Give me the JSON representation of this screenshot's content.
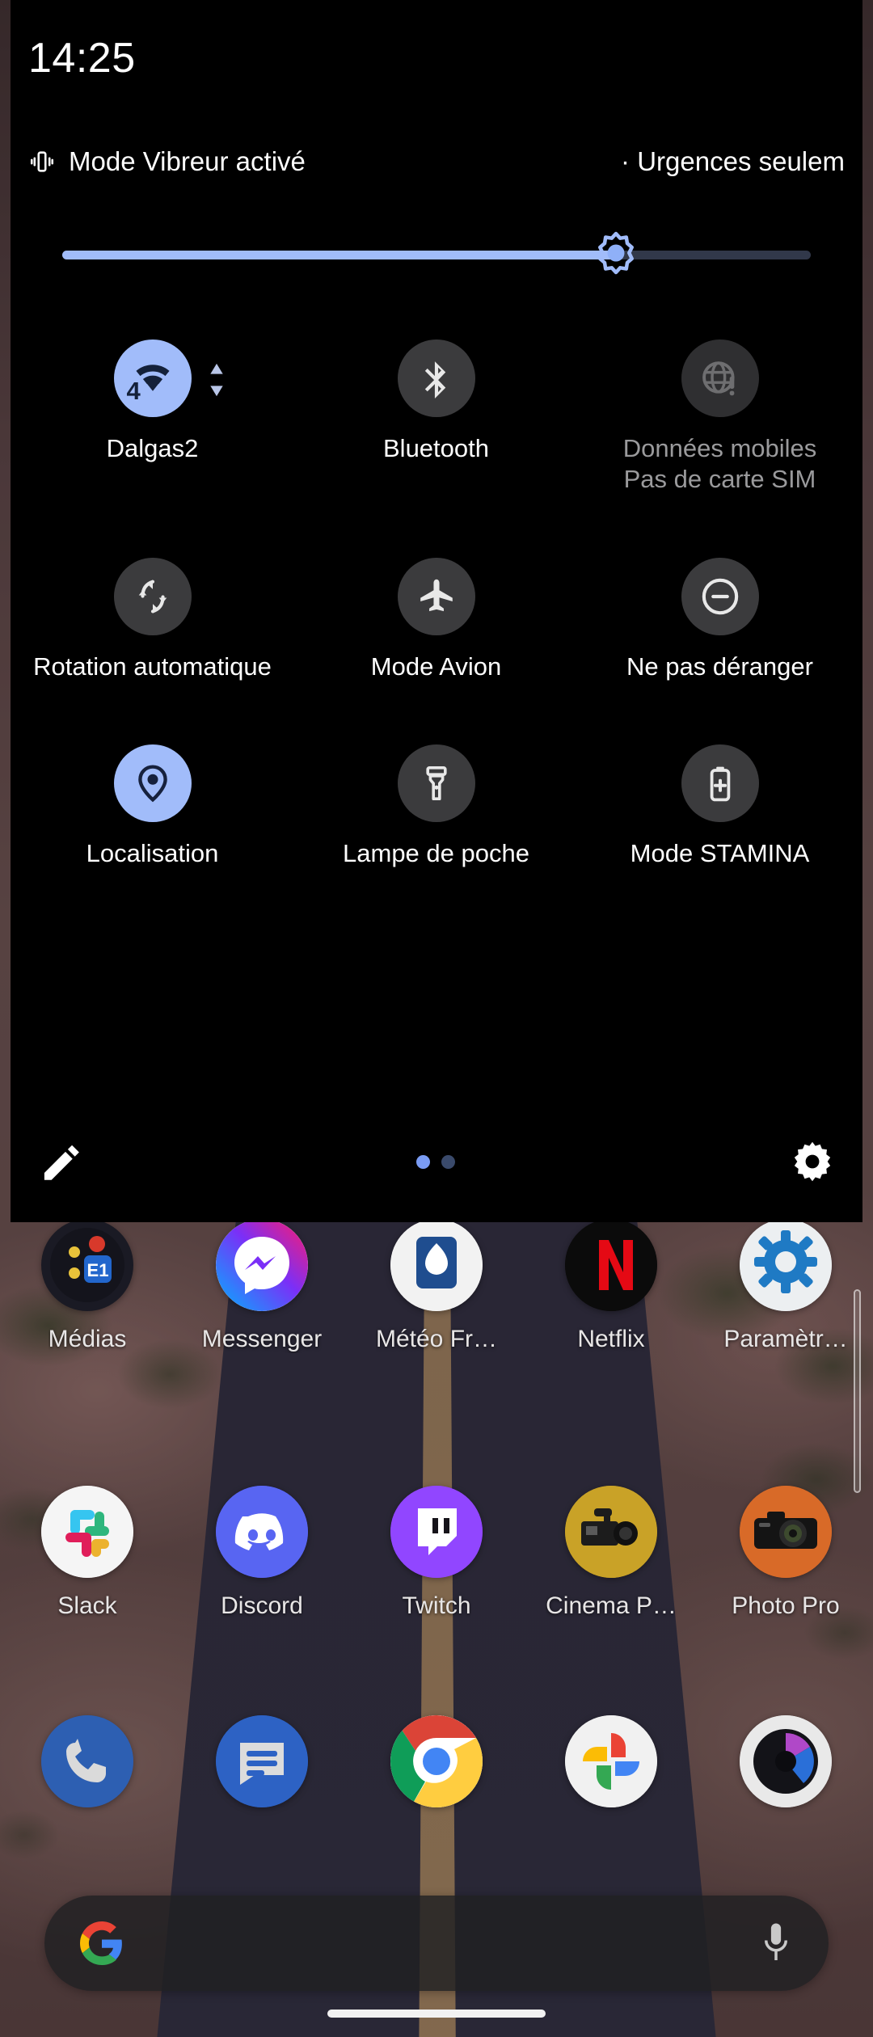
{
  "statusbar": {
    "clock": "14:25"
  },
  "qs": {
    "status_left_icon": "vibrate-icon",
    "status_left_text": "Mode Vibreur activé",
    "status_right_text": "· Urgences seulem",
    "brightness": {
      "label": "brightness-slider",
      "value_percent": 74,
      "icon": "brightness-sun-icon"
    },
    "tiles": [
      {
        "id": "wifi",
        "icon": "wifi-icon",
        "label": "Dalgas2",
        "sub": "",
        "state": "on",
        "badge": "4",
        "extra_icon": "up-down-arrows-icon"
      },
      {
        "id": "bluetooth",
        "icon": "bluetooth-icon",
        "label": "Bluetooth",
        "sub": "",
        "state": "off"
      },
      {
        "id": "mobile-data",
        "icon": "globe-alert-icon",
        "label": "Données mobiles",
        "sub": "Pas de carte SIM",
        "state": "disabled"
      },
      {
        "id": "auto-rotate",
        "icon": "rotate-icon",
        "label": "Rotation automatique",
        "sub": "",
        "state": "off"
      },
      {
        "id": "airplane-mode",
        "icon": "airplane-icon",
        "label": "Mode Avion",
        "sub": "",
        "state": "off"
      },
      {
        "id": "do-not-disturb",
        "icon": "minus-circle-icon",
        "label": "Ne pas déranger",
        "sub": "",
        "state": "off"
      },
      {
        "id": "location",
        "icon": "location-pin-icon",
        "label": "Localisation",
        "sub": "",
        "state": "on"
      },
      {
        "id": "flashlight",
        "icon": "flashlight-icon",
        "label": "Lampe de poche",
        "sub": "",
        "state": "off"
      },
      {
        "id": "stamina-mode",
        "icon": "battery-plus-icon",
        "label": "Mode STAMINA",
        "sub": "",
        "state": "off"
      }
    ],
    "footer": {
      "edit_icon": "pencil-icon",
      "settings_icon": "gear-icon",
      "pages": 2,
      "active_page": 1
    }
  },
  "home": {
    "rows": [
      [
        {
          "label": "Médias",
          "icon": "medias-app-icon"
        },
        {
          "label": "Messenger",
          "icon": "messenger-app-icon"
        },
        {
          "label": "Météo Fr…",
          "icon": "meteo-france-app-icon"
        },
        {
          "label": "Netflix",
          "icon": "netflix-app-icon"
        },
        {
          "label": "Paramètr…",
          "icon": "settings-app-icon"
        }
      ],
      [
        {
          "label": "Slack",
          "icon": "slack-app-icon"
        },
        {
          "label": "Discord",
          "icon": "discord-app-icon"
        },
        {
          "label": "Twitch",
          "icon": "twitch-app-icon"
        },
        {
          "label": "Cinema P…",
          "icon": "cinema-pro-app-icon"
        },
        {
          "label": "Photo Pro",
          "icon": "photo-pro-app-icon"
        }
      ]
    ],
    "dock": [
      {
        "label": "",
        "icon": "phone-app-icon"
      },
      {
        "label": "",
        "icon": "messages-app-icon"
      },
      {
        "label": "",
        "icon": "chrome-app-icon"
      },
      {
        "label": "",
        "icon": "google-photos-app-icon"
      },
      {
        "label": "",
        "icon": "camera-app-icon"
      }
    ],
    "search": {
      "value": "",
      "placeholder": "",
      "left_icon": "google-g-icon",
      "right_icon": "microphone-icon"
    },
    "page_scroll_indicator": "home-page-scrollbar"
  },
  "colors": {
    "accent_blue": "#a1bcfa",
    "tile_off": "#3b3b3d",
    "tile_disabled": "#2f2f31",
    "panel_bg": "#000000",
    "text_primary": "#ffffff",
    "text_secondary": "#9a9a9c"
  }
}
